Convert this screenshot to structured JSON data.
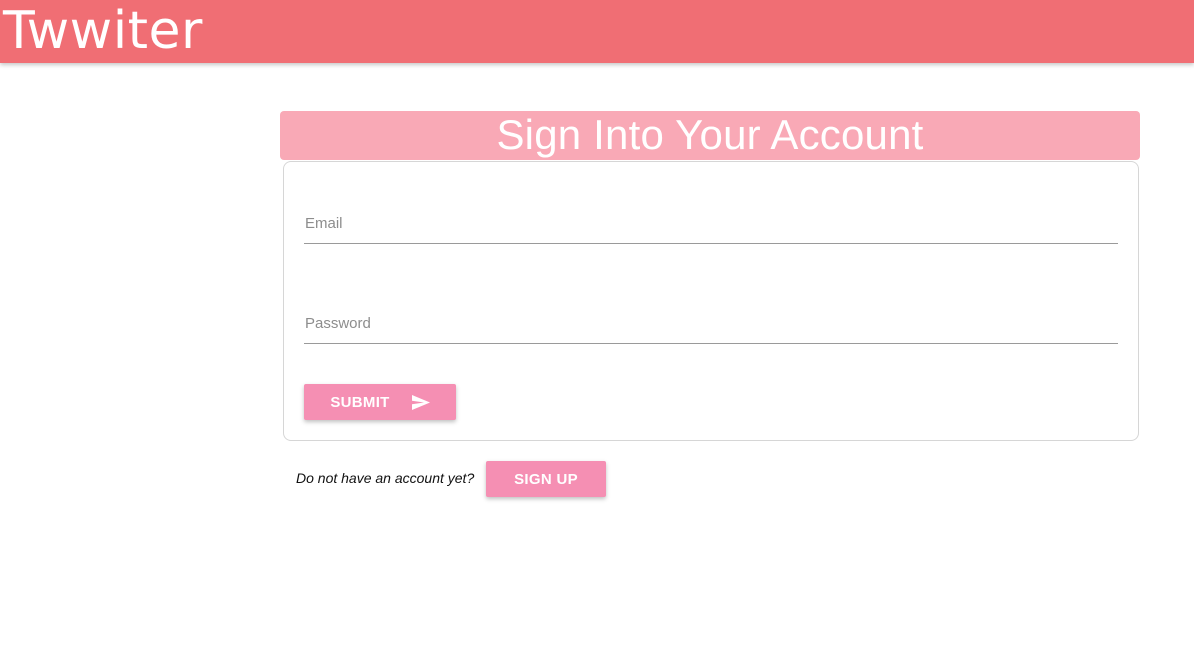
{
  "header": {
    "brand": "Twwiter"
  },
  "signin": {
    "title": "Sign Into Your Account",
    "email_placeholder": "Email",
    "password_placeholder": "Password",
    "submit_label": "SUBMIT",
    "no_account_text": "Do not have an account yet?",
    "signup_label": "SIGN UP"
  },
  "icons": {
    "submit": "send-icon"
  },
  "colors": {
    "navbar": "#f06e74",
    "card_header": "#f9a9b6",
    "button": "#f58fb3"
  }
}
